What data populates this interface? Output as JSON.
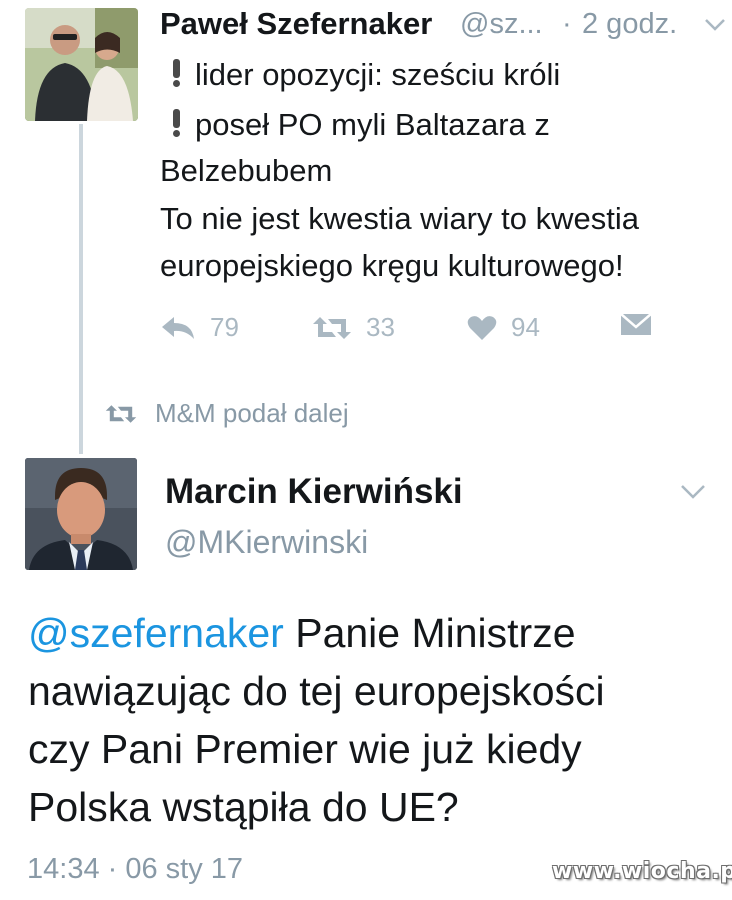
{
  "tweet1": {
    "display_name": "Paweł Szefernaker",
    "handle": "@sz...",
    "separator": "·",
    "time": "2 godz.",
    "lines": [
      "lider opozycji: sześciu króli",
      "poseł PO myli Baltazara z",
      "Belzebubem",
      "To nie jest kwestia wiary to kwestia",
      "europejskiego kręgu kulturowego!"
    ],
    "reply_count": "79",
    "retweet_count": "33",
    "like_count": "94"
  },
  "retweet_notice": {
    "text": "M&M podał dalej"
  },
  "tweet2": {
    "display_name": "Marcin Kierwiński",
    "handle": "@MKierwinski",
    "mention": "@szefernaker",
    "body_line1_rest": " Panie Ministrze",
    "body_line2": "nawiązując do tej europejskości",
    "body_line3": "czy Pani Premier wie już kiedy",
    "body_line4": "Polska wstąpiła do UE?",
    "date": "14:34 · 06 sty 17"
  },
  "watermark": "www.wiocha.pl",
  "colors": {
    "text": "#14171a",
    "muted": "#8899a6",
    "icon": "#aab8c2",
    "link": "#1b95e0",
    "thread_line": "#ccd6dd",
    "alert": "#4a4a4a"
  },
  "icons": [
    "chevron-down-icon",
    "exclamation-icon",
    "reply-icon",
    "retweet-icon",
    "heart-icon",
    "direct-message-icon"
  ]
}
